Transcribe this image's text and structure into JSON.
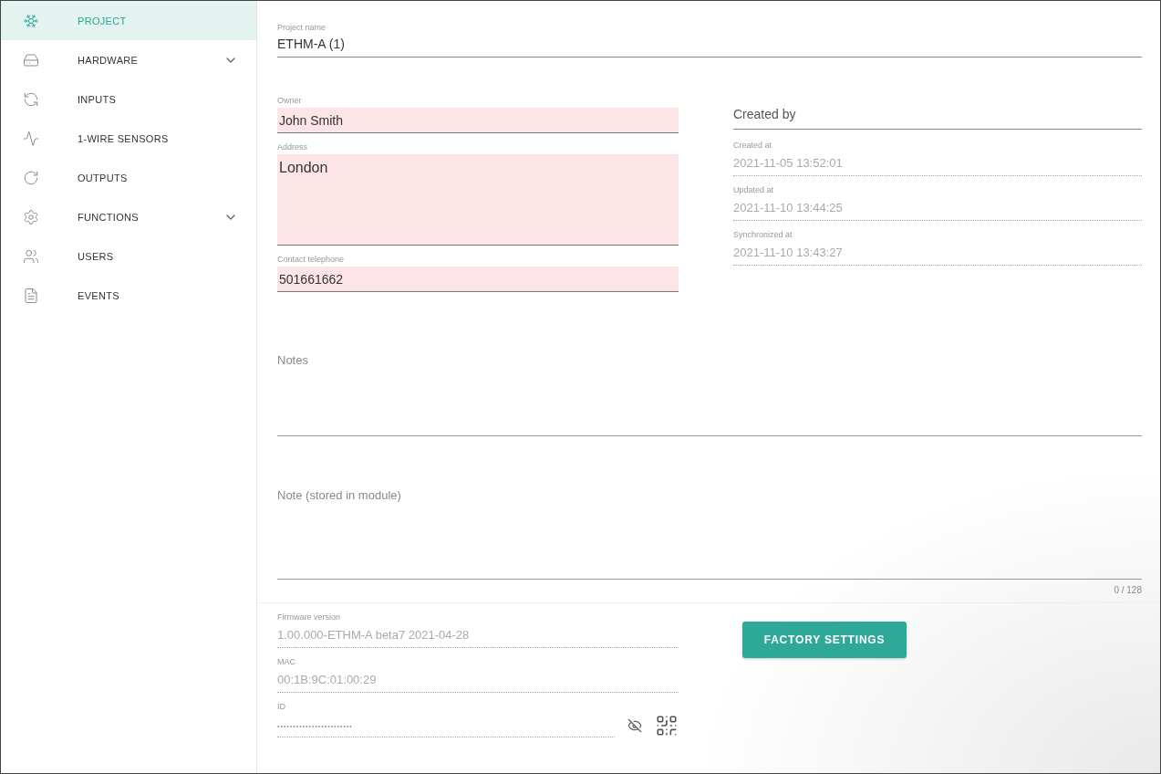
{
  "sidebar": {
    "items": [
      {
        "label": "PROJECT",
        "selected": true
      },
      {
        "label": "HARDWARE",
        "selected": false,
        "expandable": true
      },
      {
        "label": "INPUTS",
        "selected": false
      },
      {
        "label": "1-WIRE SENSORS",
        "selected": false
      },
      {
        "label": "OUTPUTS",
        "selected": false
      },
      {
        "label": "FUNCTIONS",
        "selected": false,
        "expandable": true
      },
      {
        "label": "USERS",
        "selected": false
      },
      {
        "label": "EVENTS",
        "selected": false
      }
    ]
  },
  "project_name": {
    "label": "Project name",
    "value": "ETHM-A (1)"
  },
  "owner_fields": [
    {
      "label": "Owner",
      "value": "John Smith",
      "highlighted": true
    },
    {
      "label": "Address",
      "value": "London",
      "highlighted": true,
      "multiline": true
    },
    {
      "label": "Contact telephone",
      "value": "501661662",
      "highlighted": true
    }
  ],
  "created_by": {
    "placeholder": "Created by"
  },
  "timestamps": [
    {
      "label": "Created at",
      "value": "2021-11-05 13:52:01"
    },
    {
      "label": "Updated at",
      "value": "2021-11-10 13:44:25"
    },
    {
      "label": "Synchronized at",
      "value": "2021-11-10 13:43:27"
    }
  ],
  "notes": {
    "placeholder": "Notes"
  },
  "module_note": {
    "placeholder": "Note (stored in module)",
    "counter": "0 / 128"
  },
  "device_info": [
    {
      "label": "Firmware version",
      "value": "1.00.000-ETHM-A  beta7 2021-04-28"
    },
    {
      "label": "MAC",
      "value": "00:1B:9C:01:00:29"
    }
  ],
  "id_field": {
    "label": "ID",
    "value": "••••••••••••••••••••••••"
  },
  "factory_button": {
    "label": "FACTORY SETTINGS"
  }
}
